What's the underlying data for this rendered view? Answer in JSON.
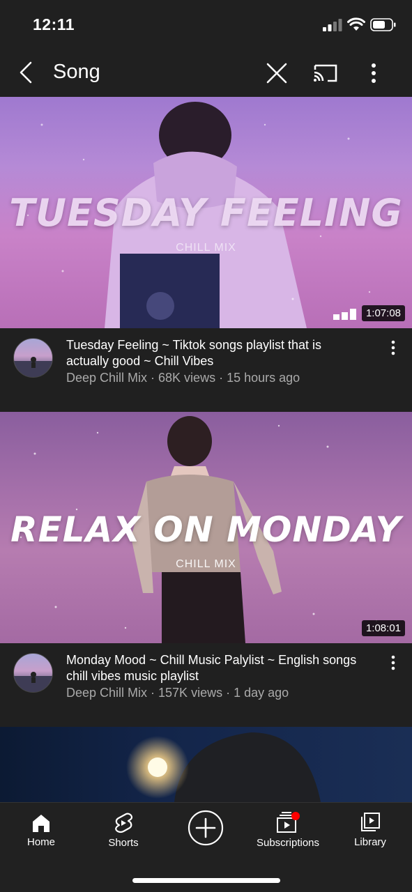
{
  "status_bar": {
    "time": "12:11"
  },
  "app_bar": {
    "query": "Song"
  },
  "videos": [
    {
      "thumb_title": "TUESDAY FEELING",
      "thumb_sub": "CHILL MIX",
      "duration": "1:07:08",
      "title": "Tuesday Feeling ~ Tiktok songs playlist that is actually good ~ Chill Vibes",
      "channel_line": "Deep Chill Mix · 68K views · 15 hours ago"
    },
    {
      "thumb_title": "RELAX ON MONDAY",
      "thumb_sub": "CHILL MIX",
      "duration": "1:08:01",
      "title": "Monday Mood ~ Chill Music Palylist ~ English songs chill vibes music playlist",
      "channel_line": "Deep Chill Mix · 157K views · 1 day ago"
    }
  ],
  "bottom_nav": {
    "items": [
      {
        "label": "Home",
        "icon": "home-icon"
      },
      {
        "label": "Shorts",
        "icon": "shorts-icon"
      },
      {
        "label": "",
        "icon": "create-icon"
      },
      {
        "label": "Subscriptions",
        "icon": "subscriptions-icon"
      },
      {
        "label": "Library",
        "icon": "library-icon"
      }
    ]
  },
  "colors": {
    "background": "#202020",
    "notification_dot": "#ff0000",
    "secondary_text": "#aaaaaa"
  }
}
